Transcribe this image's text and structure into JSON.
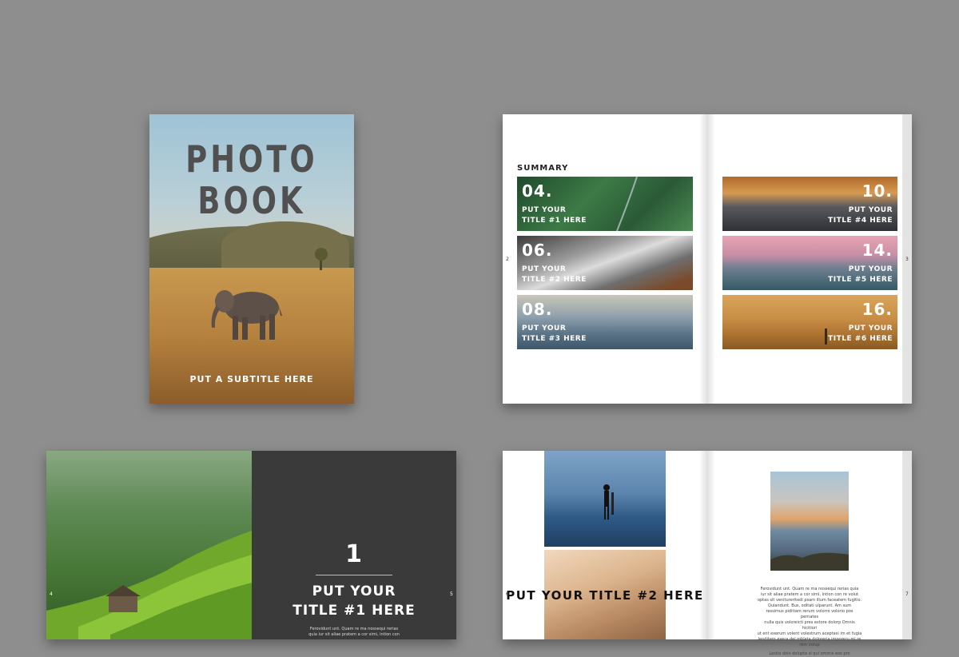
{
  "cover": {
    "title_line1": "PHOTO",
    "title_line2": "BOOK",
    "subtitle": "PUT A SUBTITLE HERE"
  },
  "summary": {
    "heading": "SUMMARY",
    "left_page_number": "2",
    "right_page_number": "3",
    "entries": [
      {
        "number": "04.",
        "title_line1": "PUT YOUR",
        "title_line2": "TITLE #1 HERE"
      },
      {
        "number": "06.",
        "title_line1": "PUT YOUR",
        "title_line2": "TITLE #2 HERE"
      },
      {
        "number": "08.",
        "title_line1": "PUT YOUR",
        "title_line2": "TITLE #3 HERE"
      },
      {
        "number": "10.",
        "title_line1": "PUT YOUR",
        "title_line2": "TITLE #4 HERE"
      },
      {
        "number": "14.",
        "title_line1": "PUT YOUR",
        "title_line2": "TITLE #5 HERE"
      },
      {
        "number": "16.",
        "title_line1": "PUT YOUR",
        "title_line2": "TITLE #6 HERE"
      }
    ]
  },
  "chapter1": {
    "number": "1",
    "title_line1": "PUT YOUR",
    "title_line2": "TITLE #1 HERE",
    "body_line1": "Ferovidunt unt. Quam re ma nossequi rerias",
    "body_line2": "quia iur sit aliae pratem a cor simi, intion con",
    "left_page_number": "4",
    "right_page_number": "5"
  },
  "chapter2": {
    "title": "PUT YOUR TITLE #2 HERE",
    "left_page_number": "6",
    "right_page_number": "7",
    "body_paragraph1": [
      "Ferovidunt unt. Quam re ma nossequi rerias quia",
      "iur sit aliae pratem a cor simi, intion con re volut",
      "optas sit venitureritedi psam illum faceatem fugitio.",
      "Quiandunt. Bus, oditati ulparunt. Am sum",
      "ressimus piditiam rerum volorro volorio pos pernates",
      "nulla quis voloreicti pres estore dolorp Omnis hicitiori",
      "ut ent exerum volent volestrum aceptasi im et fugia",
      "lenditem exera del mbleta doloreria imporeru mi re",
      "rem volup"
    ],
    "body_paragraph2": "Lestia dolo dolupta si qui ommis eos pro"
  }
}
